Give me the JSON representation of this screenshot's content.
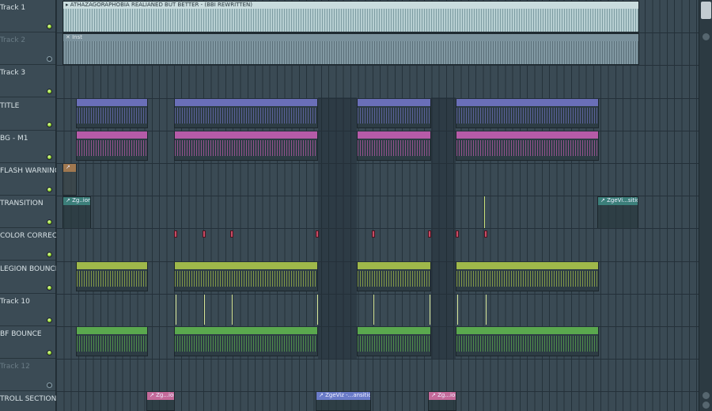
{
  "tracks": [
    {
      "name": "Track 1",
      "dim": false,
      "led": true
    },
    {
      "name": "Track 2",
      "dim": true,
      "led": false
    },
    {
      "name": "Track 3",
      "dim": false,
      "led": true
    },
    {
      "name": "TITLE",
      "dim": false,
      "led": true
    },
    {
      "name": "BG - M1",
      "dim": false,
      "led": true
    },
    {
      "name": "FLASH WARNING",
      "dim": false,
      "led": true
    },
    {
      "name": "TRANSITION",
      "dim": false,
      "led": true
    },
    {
      "name": "COLOR CORRECTION",
      "dim": false,
      "led": true
    },
    {
      "name": "LEGION BOUNCE",
      "dim": false,
      "led": true
    },
    {
      "name": "Track 10",
      "dim": false,
      "led": true
    },
    {
      "name": "BF BOUNCE",
      "dim": false,
      "led": true
    },
    {
      "name": "Track 12",
      "dim": true,
      "led": false
    },
    {
      "name": "TROLL SECTIONS",
      "dim": false,
      "led": true
    }
  ],
  "clips": {
    "audio_main": "▸ ATHAZAGORAPHOBIA REALIANED BUT BETTER - (BBI REWRITTEN)",
    "audio_inst": "✕ Inst",
    "transition_1": "↗ Zg..ion",
    "transition_2": "↗ ZgeVi...sition",
    "flash": "↗",
    "troll_1": "↗ Zg...ion",
    "troll_2": "↗ ZgeViz -...ansition",
    "troll_3": "↗ Zg...ion"
  },
  "colors": {
    "title": "#6a6fb8",
    "bg_m1": "#b65ba8",
    "legion": "#9fb84a",
    "bf": "#5aa84e",
    "marker": "#c74a64"
  }
}
